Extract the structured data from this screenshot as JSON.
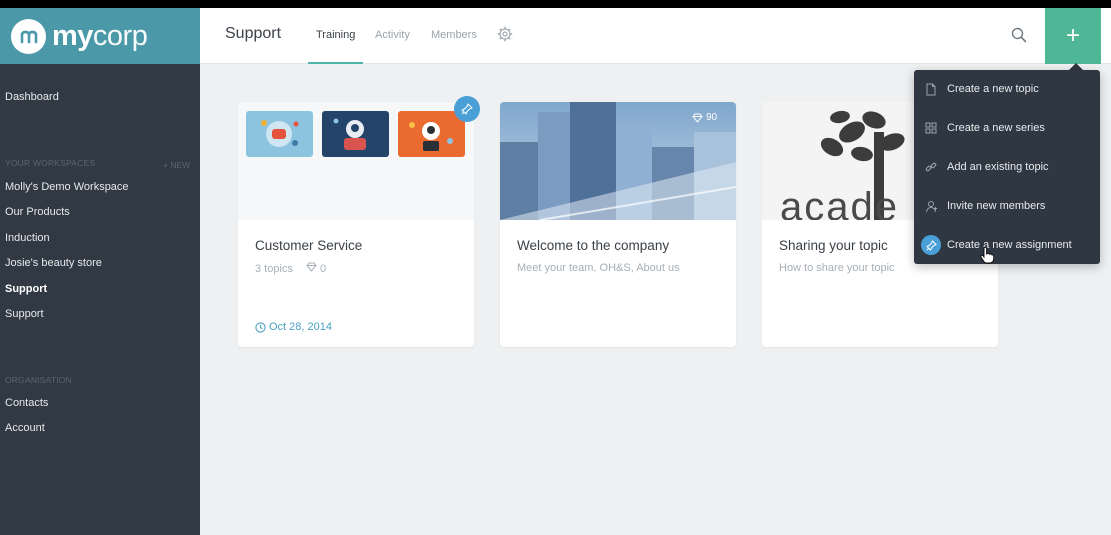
{
  "brand": {
    "name_bold": "my",
    "name_light": "corp"
  },
  "sidebar": {
    "dashboard": "Dashboard",
    "workspaces_heading": "YOUR WORKSPACES",
    "new_label": "+ NEW",
    "workspaces": [
      {
        "label": "Molly's Demo Workspace",
        "active": false
      },
      {
        "label": "Our Products",
        "active": false
      },
      {
        "label": "Induction",
        "active": false
      },
      {
        "label": "Josie's beauty store",
        "active": false
      },
      {
        "label": "Support",
        "active": true
      },
      {
        "label": "Support",
        "active": false
      }
    ],
    "organisation_heading": "ORGANISATION",
    "organisation_items": [
      "Contacts",
      "Account"
    ]
  },
  "header": {
    "title": "Support",
    "tabs": [
      {
        "label": "Training",
        "active": true
      },
      {
        "label": "Activity",
        "active": false
      },
      {
        "label": "Members",
        "active": false
      }
    ],
    "plus_label": "+"
  },
  "cards": [
    {
      "title": "Customer Service",
      "topics": "3 topics",
      "likes": "0",
      "date": "Oct 28, 2014"
    },
    {
      "title": "Welcome to the company",
      "subtitle": "Meet your team, OH&S, About us",
      "likes": "90"
    },
    {
      "title": "Sharing your topic",
      "subtitle": "How to share your topic",
      "image_text": "acade"
    }
  ],
  "dropdown": {
    "items": [
      {
        "label": "Create a new topic",
        "icon": "document-icon"
      },
      {
        "label": "Create a new series",
        "icon": "grid-icon"
      },
      {
        "label": "Add an existing topic",
        "icon": "link-icon"
      },
      {
        "label": "Invite new members",
        "icon": "person-add-icon"
      },
      {
        "label": "Create a new assignment",
        "icon": "pin-icon"
      }
    ]
  },
  "colors": {
    "sidebar_bg": "#313a44",
    "logo_bg": "#4a98a8",
    "accent_green": "#4fb795",
    "accent_blue": "#4a9fd6",
    "tab_underline": "#4db6a6"
  }
}
